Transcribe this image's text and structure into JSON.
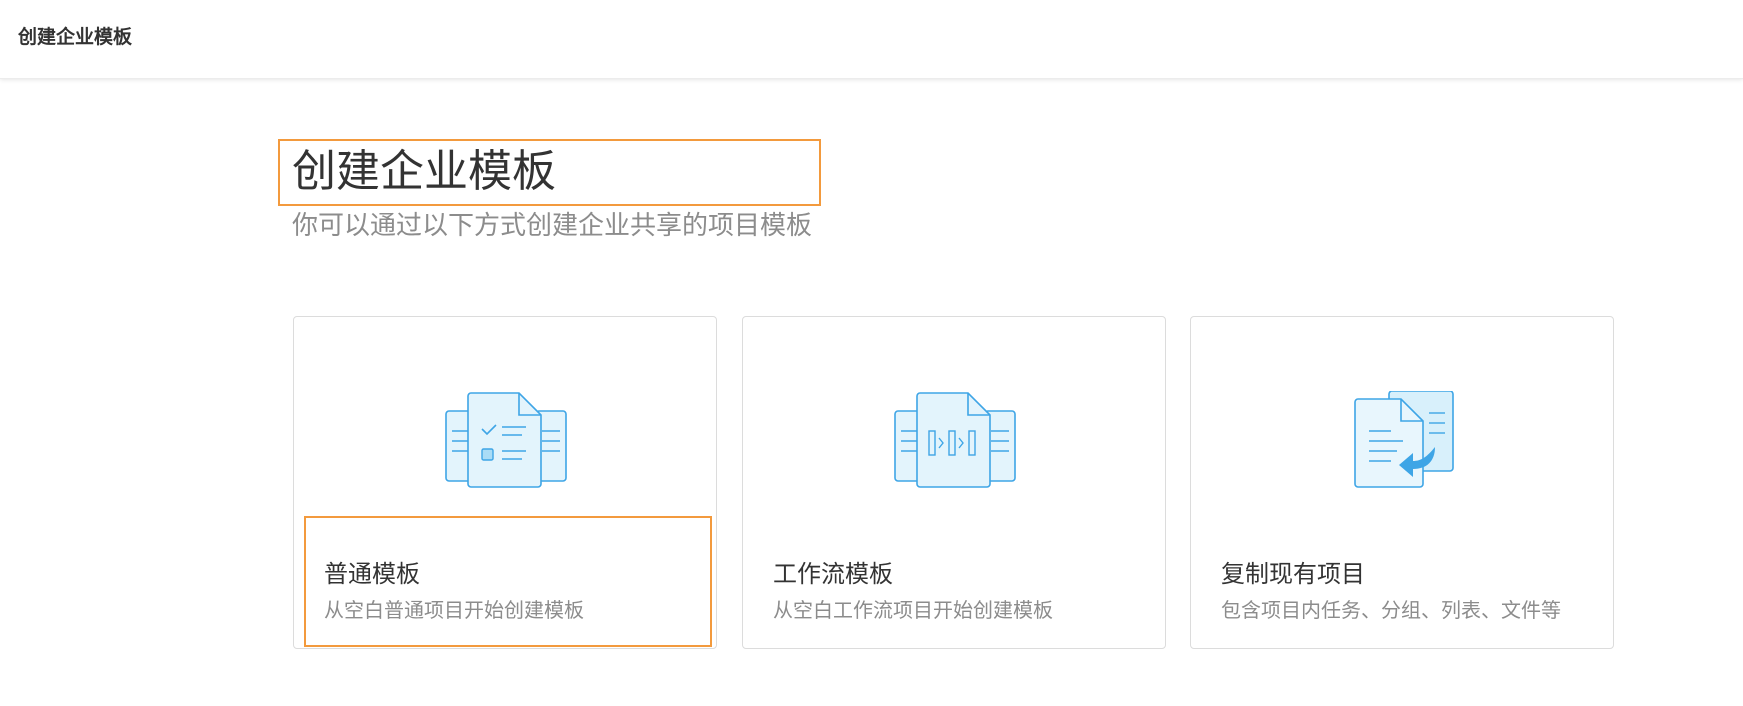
{
  "header": {
    "title": "创建企业模板"
  },
  "hero": {
    "title": "创建企业模板",
    "subtitle": "你可以通过以下方式创建企业共享的项目模板"
  },
  "cards": [
    {
      "title": "普通模板",
      "desc": "从空白普通项目开始创建模板",
      "icon": "checklist-document-icon"
    },
    {
      "title": "工作流模板",
      "desc": "从空白工作流项目开始创建模板",
      "icon": "workflow-document-icon"
    },
    {
      "title": "复制现有项目",
      "desc": "包含项目内任务、分组、列表、文件等",
      "icon": "copy-document-icon"
    }
  ],
  "colors": {
    "accent_blue": "#3ea5e6",
    "icon_fill": "#e3f4fc",
    "highlight_orange": "#f39a3d"
  }
}
